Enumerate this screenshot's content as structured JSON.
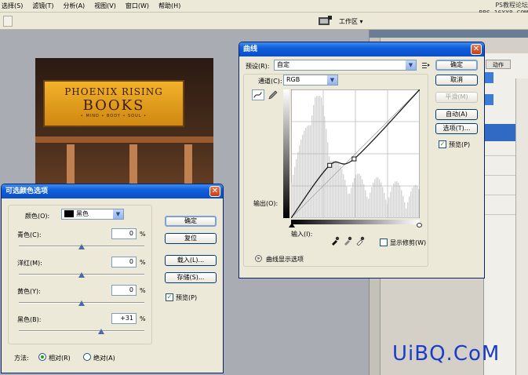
{
  "menubar": {
    "items": [
      "选择(S)",
      "滤镜(T)",
      "分析(A)",
      "视图(V)",
      "窗口(W)",
      "帮助(H)"
    ]
  },
  "optbar": {
    "workspace_label": "工作区 ▾"
  },
  "watermark_top": {
    "line1": "PS教程论坛",
    "line2": "BBS.16XX8.COM"
  },
  "bottom_watermark": "UiBQ.CoM",
  "image": {
    "sign_line1": "PHOENIX RISING",
    "sign_line2": "BOOKS",
    "sign_line3": "• MIND • BODY • SOUL •"
  },
  "dock": {
    "panel_tab": "动作"
  },
  "curves": {
    "title": "曲线",
    "preset_label": "预设(R):",
    "preset_value": "自定",
    "channel_label": "通道(C):",
    "channel_value": "RGB",
    "output_label": "输出(O):",
    "input_label": "输入(I):",
    "show_clipping_label": "显示修剪(W)",
    "show_clipping": false,
    "curve_display_options": "曲线显示选项",
    "buttons": {
      "ok": "确定",
      "cancel": "取消",
      "smooth": "平滑(M)",
      "auto": "自动(A)",
      "options": "选项(T)..."
    },
    "preview_label": "预览(P)",
    "preview": true,
    "curve_points_pct": [
      [
        0,
        0
      ],
      [
        30,
        41
      ],
      [
        49,
        46
      ],
      [
        100,
        100
      ]
    ],
    "colors": {
      "title_blue": "#0a4fc7",
      "curve": "#1a1a1a"
    }
  },
  "selective_color": {
    "title": "可选颜色选项",
    "color_label": "颜色(O):",
    "color_value": "黑色",
    "sliders": [
      {
        "label": "青色(C):",
        "value": "0",
        "unit": "%",
        "pct": 0
      },
      {
        "label": "洋红(M):",
        "value": "0",
        "unit": "%",
        "pct": 0
      },
      {
        "label": "黄色(Y):",
        "value": "0",
        "unit": "%",
        "pct": 0
      },
      {
        "label": "黑色(B):",
        "value": "+31",
        "unit": "%",
        "pct": 31
      }
    ],
    "method_label": "方法:",
    "method_relative": "相对(R)",
    "method_absolute": "绝对(A)",
    "method_selected": "relative",
    "buttons": {
      "ok": "确定",
      "reset": "复位",
      "load": "载入(L)...",
      "save": "存储(S)..."
    },
    "preview_label": "预览(P)",
    "preview": true
  }
}
